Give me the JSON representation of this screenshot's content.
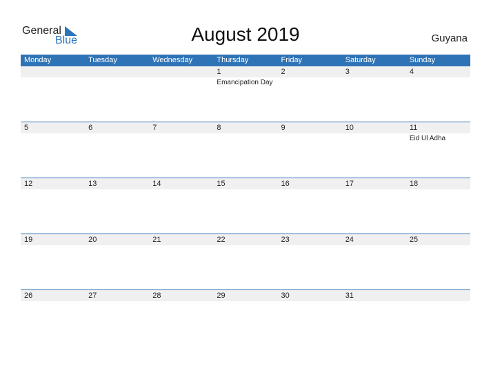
{
  "logo": {
    "general": "General",
    "blue": "Blue"
  },
  "title": "August 2019",
  "country": "Guyana",
  "weekdays": [
    "Monday",
    "Tuesday",
    "Wednesday",
    "Thursday",
    "Friday",
    "Saturday",
    "Sunday"
  ],
  "weeks": [
    [
      {
        "d": ""
      },
      {
        "d": ""
      },
      {
        "d": ""
      },
      {
        "d": "1",
        "ev": "Emancipation Day"
      },
      {
        "d": "2"
      },
      {
        "d": "3"
      },
      {
        "d": "4"
      }
    ],
    [
      {
        "d": "5"
      },
      {
        "d": "6"
      },
      {
        "d": "7"
      },
      {
        "d": "8"
      },
      {
        "d": "9"
      },
      {
        "d": "10"
      },
      {
        "d": "11",
        "ev": "Eid Ul Adha"
      }
    ],
    [
      {
        "d": "12"
      },
      {
        "d": "13"
      },
      {
        "d": "14"
      },
      {
        "d": "15"
      },
      {
        "d": "16"
      },
      {
        "d": "17"
      },
      {
        "d": "18"
      }
    ],
    [
      {
        "d": "19"
      },
      {
        "d": "20"
      },
      {
        "d": "21"
      },
      {
        "d": "22"
      },
      {
        "d": "23"
      },
      {
        "d": "24"
      },
      {
        "d": "25"
      }
    ],
    [
      {
        "d": "26"
      },
      {
        "d": "27"
      },
      {
        "d": "28"
      },
      {
        "d": "29"
      },
      {
        "d": "30"
      },
      {
        "d": "31"
      },
      {
        "d": ""
      }
    ]
  ],
  "colors": {
    "accent": "#2e73b5",
    "strip": "#f0f0f0"
  }
}
